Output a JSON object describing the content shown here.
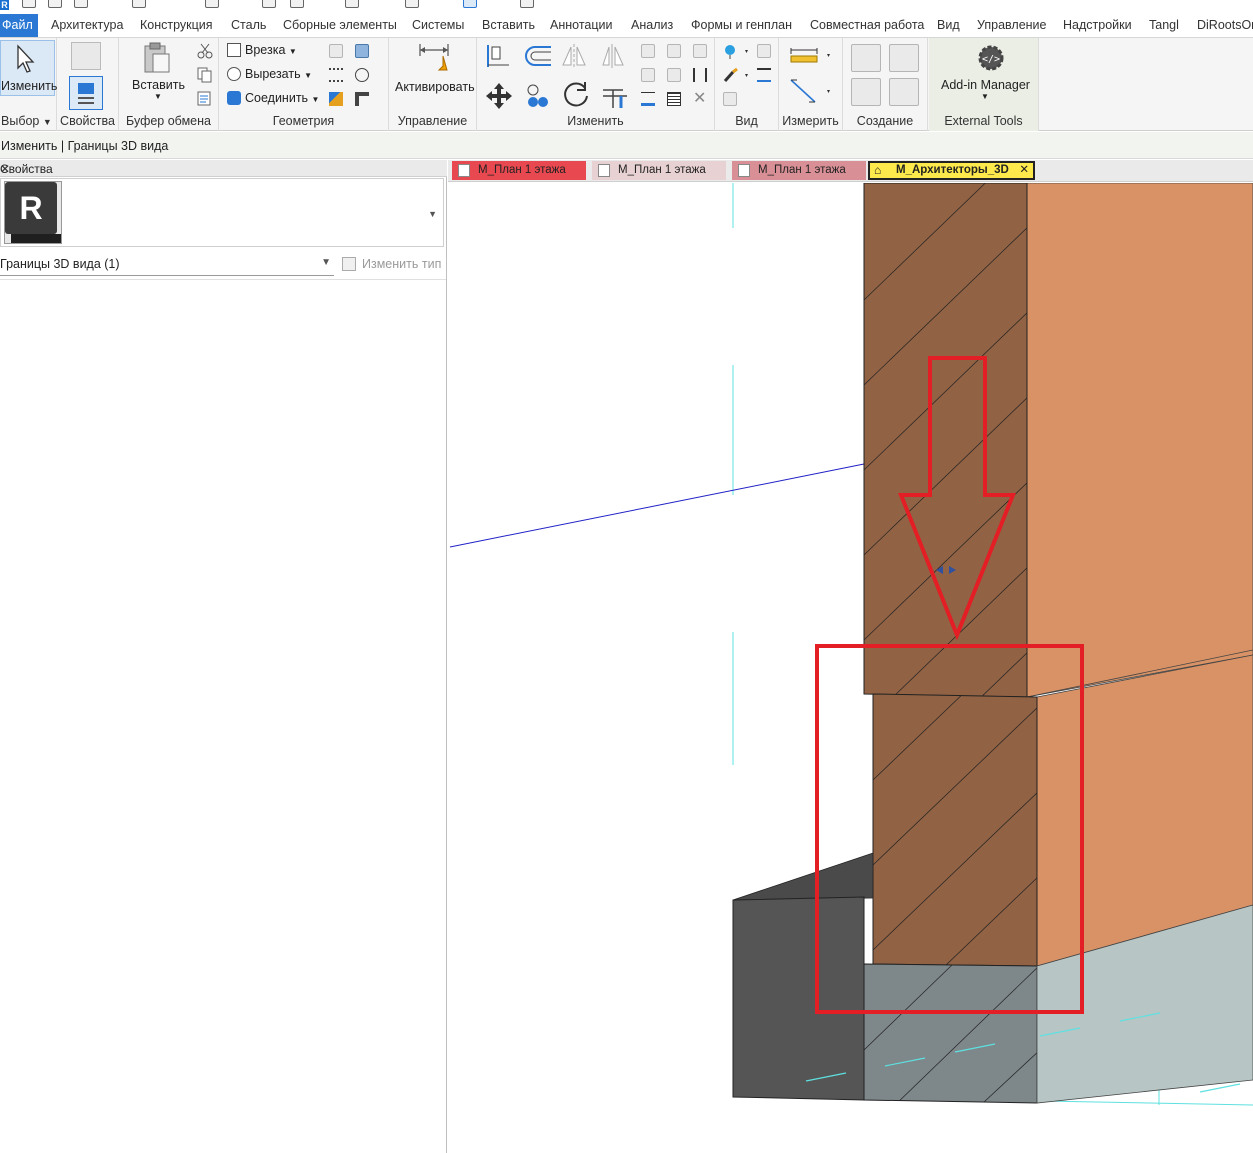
{
  "ribbon_tabs": [
    "Файл",
    "Архитектура",
    "Конструкция",
    "Сталь",
    "Сборные элементы",
    "Системы",
    "Вставить",
    "Аннотации",
    "Анализ",
    "Формы и генплан",
    "Совместная работа",
    "Вид",
    "Управление",
    "Надстройки",
    "Tangl",
    "DiRootsOne"
  ],
  "ribbon": {
    "select": {
      "modify_label": "Изменить",
      "title": "Выбор"
    },
    "properties": {
      "title": "Свойства"
    },
    "clipboard": {
      "paste_label": "Вставить",
      "title": "Буфер обмена"
    },
    "geometry": {
      "cope_label": "Врезка",
      "cut_label": "Вырезать",
      "join_label": "Соединить",
      "title": "Геометрия"
    },
    "control": {
      "activate_label": "Активировать",
      "title": "Управление"
    },
    "modify": {
      "title": "Изменить"
    },
    "view": {
      "title": "Вид"
    },
    "measure": {
      "title": "Измерить"
    },
    "create": {
      "title": "Создание"
    },
    "external": {
      "addin_label": "Add-in Manager",
      "title": "External Tools"
    }
  },
  "options_bar": {
    "context": "Изменить | Границы 3D вида"
  },
  "properties_palette": {
    "title": "Свойства",
    "type_icon_letter": "R",
    "instance_filter": "Границы 3D вида (1)",
    "edit_type_label": "Изменить тип"
  },
  "view_tabs": [
    {
      "label": "М_План 1 этажа",
      "color": "#e8484f",
      "active": false
    },
    {
      "label": "М_План 1 этажа",
      "color": "#e8d1d2",
      "active": false
    },
    {
      "label": "М_План 1 этажа",
      "color": "#d88f96",
      "active": false
    },
    {
      "label": "М_Архитекторы_3D",
      "color": "#fde94b",
      "active": true
    }
  ],
  "colors": {
    "wall_cut": "#916244",
    "wall_face": "#d89266",
    "foundation_dark": "#555555",
    "foundation_mid": "#7e878a",
    "foundation_light": "#b7c6c5",
    "annotation_red": "#e31e24",
    "ribbon_accent": "#2a78d4",
    "active_tab": "#fde94b"
  }
}
